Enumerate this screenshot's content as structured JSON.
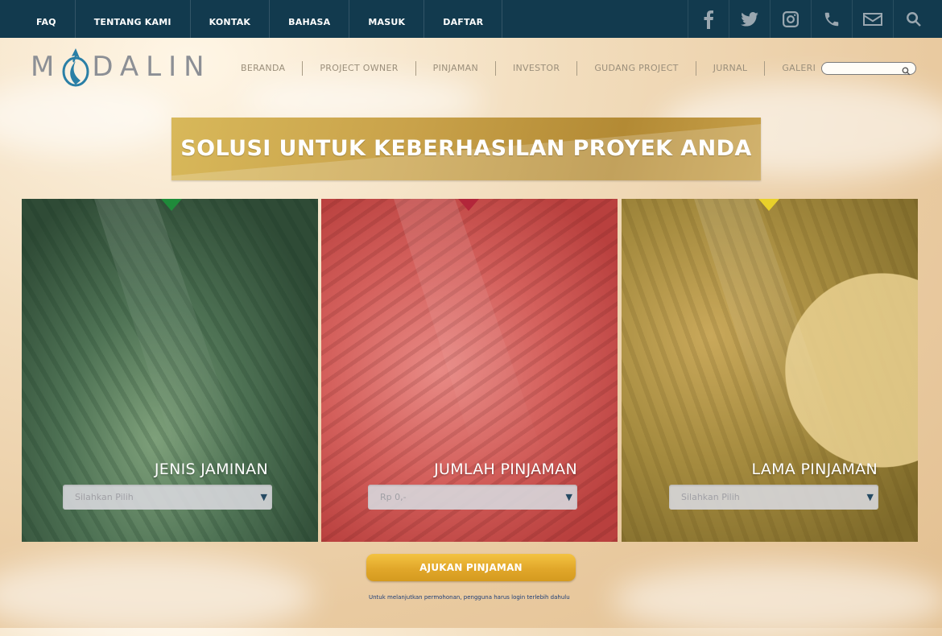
{
  "topnav": {
    "items": [
      "FAQ",
      "TENTANG KAMI",
      "KONTAK",
      "BAHASA",
      "MASUK",
      "DAFTAR"
    ]
  },
  "social_icons": [
    "facebook-icon",
    "twitter-icon",
    "instagram-icon",
    "phone-icon",
    "mail-icon",
    "search-icon"
  ],
  "logo": {
    "text_left": "M",
    "text_right": "DALIN"
  },
  "mainnav": {
    "items": [
      "BERANDA",
      "PROJECT OWNER",
      "PINJAMAN",
      "INVESTOR",
      "GUDANG PROJECT",
      "JURNAL",
      "GALERI"
    ]
  },
  "search": {
    "placeholder": ""
  },
  "banner": {
    "text": "SOLUSI UNTUK KEBERHASILAN PROYEK ANDA"
  },
  "panels": [
    {
      "title": "JENIS JAMINAN",
      "select_value": "Silahkan Pilih",
      "accent": "#1f8a3a"
    },
    {
      "title": "JUMLAH PINJAMAN",
      "select_value": "Rp 0,-",
      "accent": "#b3263a"
    },
    {
      "title": "LAMA PINJAMAN",
      "select_value": "Silahkan Pilih",
      "accent": "#e8d02a"
    }
  ],
  "cta": {
    "label": "AJUKAN PINJAMAN"
  },
  "note": {
    "text": "Untuk melanjutkan permohonan, pengguna harus login terlebih dahulu"
  },
  "colors": {
    "topbar": "#123a4e",
    "gold": "#e1a72a",
    "logo_blue": "#2a7fa6"
  }
}
